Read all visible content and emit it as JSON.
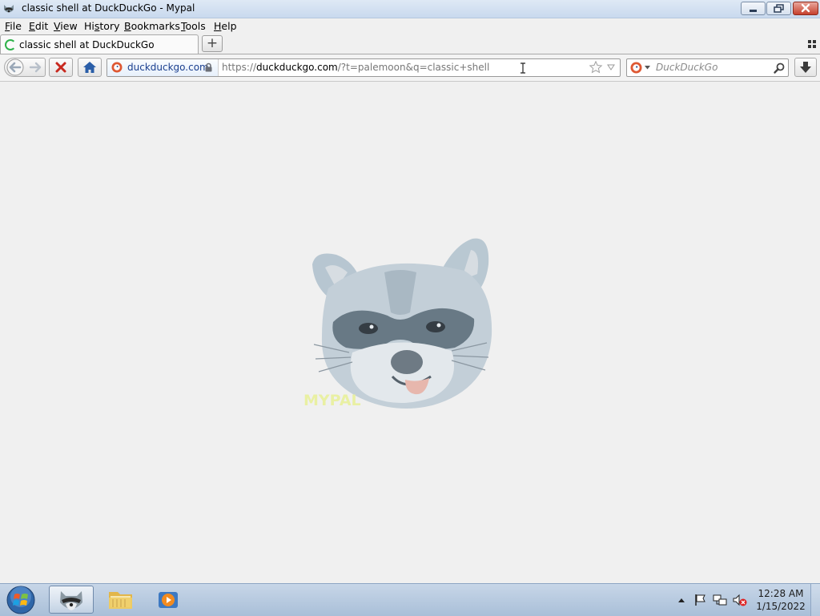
{
  "window": {
    "title": "classic shell at DuckDuckGo - Mypal"
  },
  "menu": {
    "file": {
      "acc": "F",
      "rest": "ile"
    },
    "edit": {
      "acc": "E",
      "rest": "dit"
    },
    "view": {
      "acc": "V",
      "rest": "iew"
    },
    "history": {
      "pre": "Hi",
      "acc": "s",
      "rest": "tory"
    },
    "bookmarks": {
      "acc": "B",
      "rest": "ookmarks"
    },
    "tools": {
      "acc": "T",
      "rest": "ools"
    },
    "help": {
      "acc": "H",
      "rest": "elp"
    }
  },
  "tabs": [
    {
      "label": "classic shell at DuckDuckGo",
      "loading": true
    }
  ],
  "newtab_label": "+",
  "urlbar": {
    "identity_domain": "duckduckgo.com",
    "scheme": "https://",
    "host": "duckduckgo.com",
    "path": "/?t=palemoon&q=classic+shell"
  },
  "searchbar": {
    "engine": "DuckDuckGo",
    "placeholder": "DuckDuckGo"
  },
  "content": {
    "logo_word": "MYPAL"
  },
  "taskbar": {
    "time": "12:28 AM",
    "date": "1/15/2022"
  },
  "icons": {
    "app": "raccoon-icon",
    "back": "back-arrow-icon",
    "forward": "forward-arrow-icon",
    "stop": "stop-x-icon",
    "home": "home-icon",
    "lock": "lock-icon",
    "star": "bookmark-star-icon",
    "download": "download-arrow-icon",
    "search": "magnifier-icon"
  },
  "colors": {
    "stop_red": "#c8281e",
    "home_blue": "#2a5ea8",
    "loading_green": "#2eb24a",
    "ddg_orange": "#de5833",
    "link_blue": "#1a3f8e"
  }
}
